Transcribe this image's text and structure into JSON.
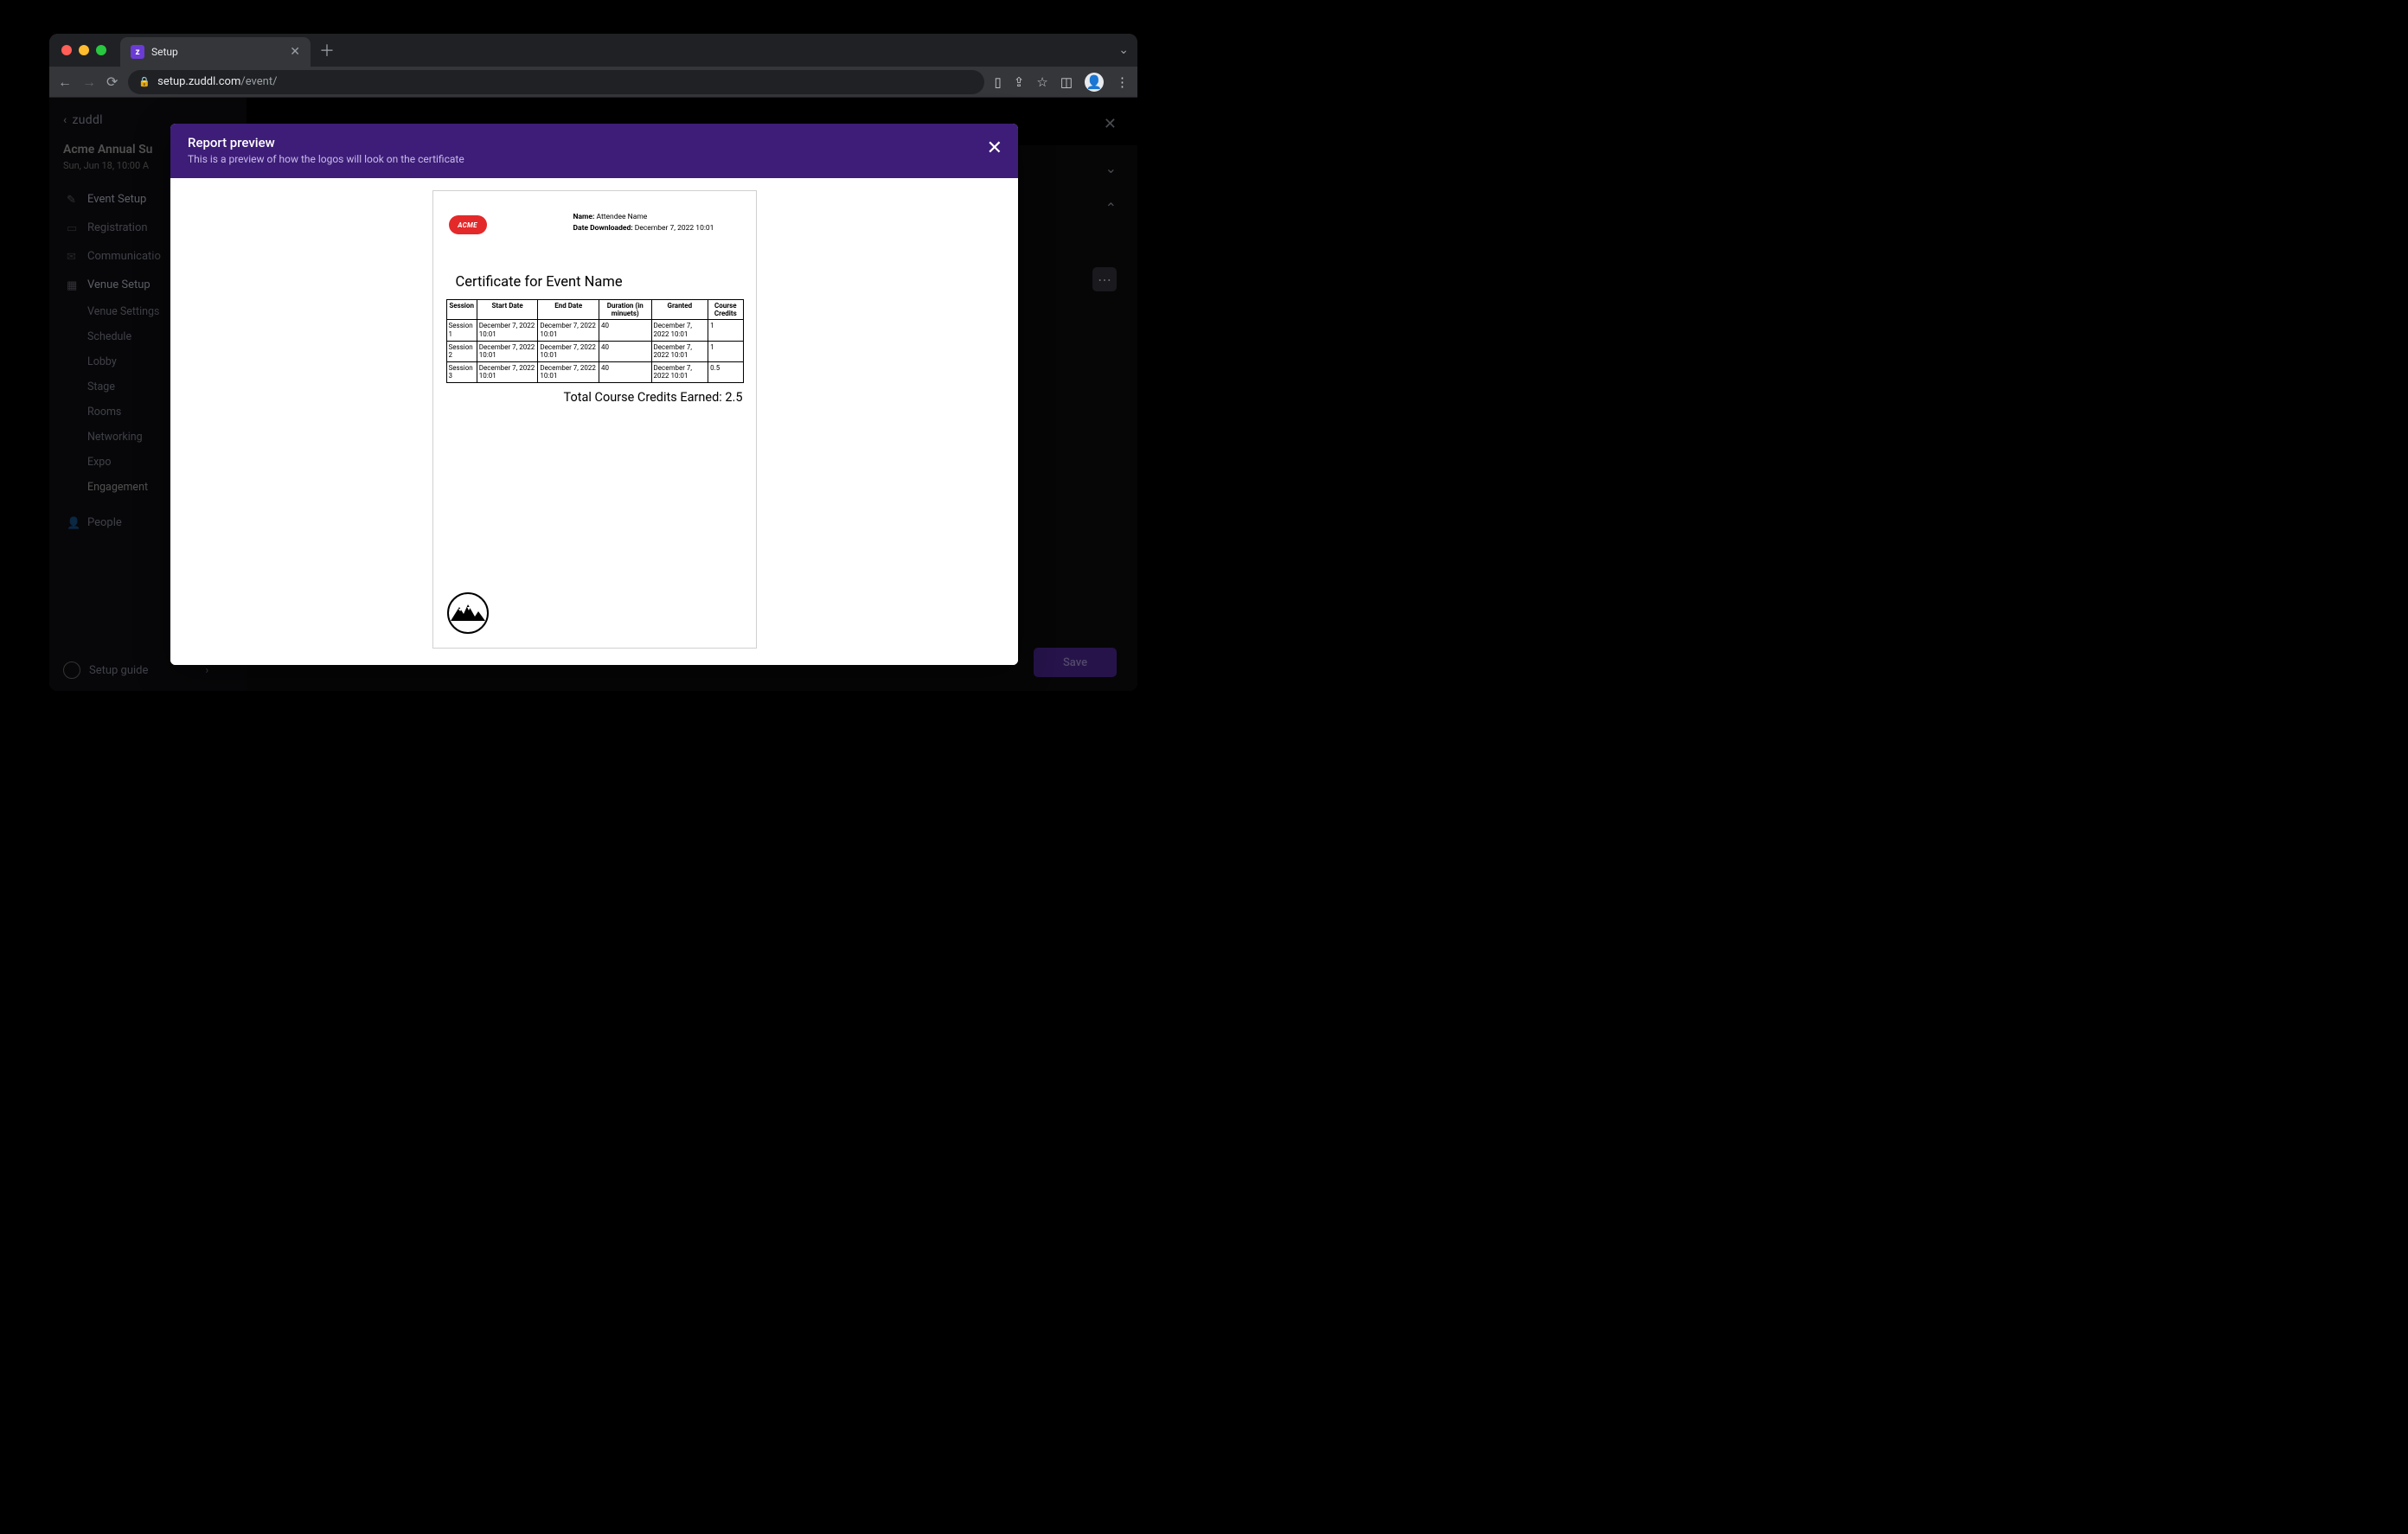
{
  "browser": {
    "tab_title": "Setup",
    "tab_favicon_letter": "z",
    "url_host": "setup.zuddl.com",
    "url_path": "/event/"
  },
  "app": {
    "brand": "zuddl",
    "event_title": "Acme Annual Su",
    "event_date": "Sun, Jun 18, 10:00 A",
    "nav": {
      "event_setup": "Event Setup",
      "registration": "Registration",
      "communication": "Communicatio",
      "venue_setup": "Venue Setup",
      "people": "People"
    },
    "subnav": {
      "venue_settings": "Venue Settings",
      "schedule": "Schedule",
      "lobby": "Lobby",
      "stage": "Stage",
      "rooms": "Rooms",
      "networking": "Networking",
      "expo": "Expo",
      "engagement": "Engagement"
    },
    "setup_guide": "Setup guide",
    "save_button": "Save",
    "dots": "⋯"
  },
  "modal": {
    "title": "Report preview",
    "subtitle": "This is a preview of how the logos will look on the certificate"
  },
  "certificate": {
    "logo_text": "ACME",
    "name_label": "Name:",
    "name_value": "Attendee Name",
    "date_label": "Date Downloaded:",
    "date_value": "December 7, 2022 10:01",
    "title": "Certificate for Event Name",
    "headers": {
      "session": "Session",
      "start": "Start Date",
      "end": "End Date",
      "duration": "Duration (in minuets)",
      "granted": "Granted",
      "credits": "Course Credits"
    },
    "rows": [
      {
        "session": "Session 1",
        "start": "December 7, 2022 10:01",
        "end": "December 7, 2022 10:01",
        "duration": "40",
        "granted": "December 7, 2022 10:01",
        "credits": "1"
      },
      {
        "session": "Session 2",
        "start": "December 7, 2022 10:01",
        "end": "December 7, 2022 10:01",
        "duration": "40",
        "granted": "December 7, 2022 10:01",
        "credits": "1"
      },
      {
        "session": "Session 3",
        "start": "December 7, 2022 10:01",
        "end": "December 7, 2022 10:01",
        "duration": "40",
        "granted": "December 7, 2022 10:01",
        "credits": "0.5"
      }
    ],
    "total_label": "Total Course Credits Earned: ",
    "total_value": "2.5"
  }
}
